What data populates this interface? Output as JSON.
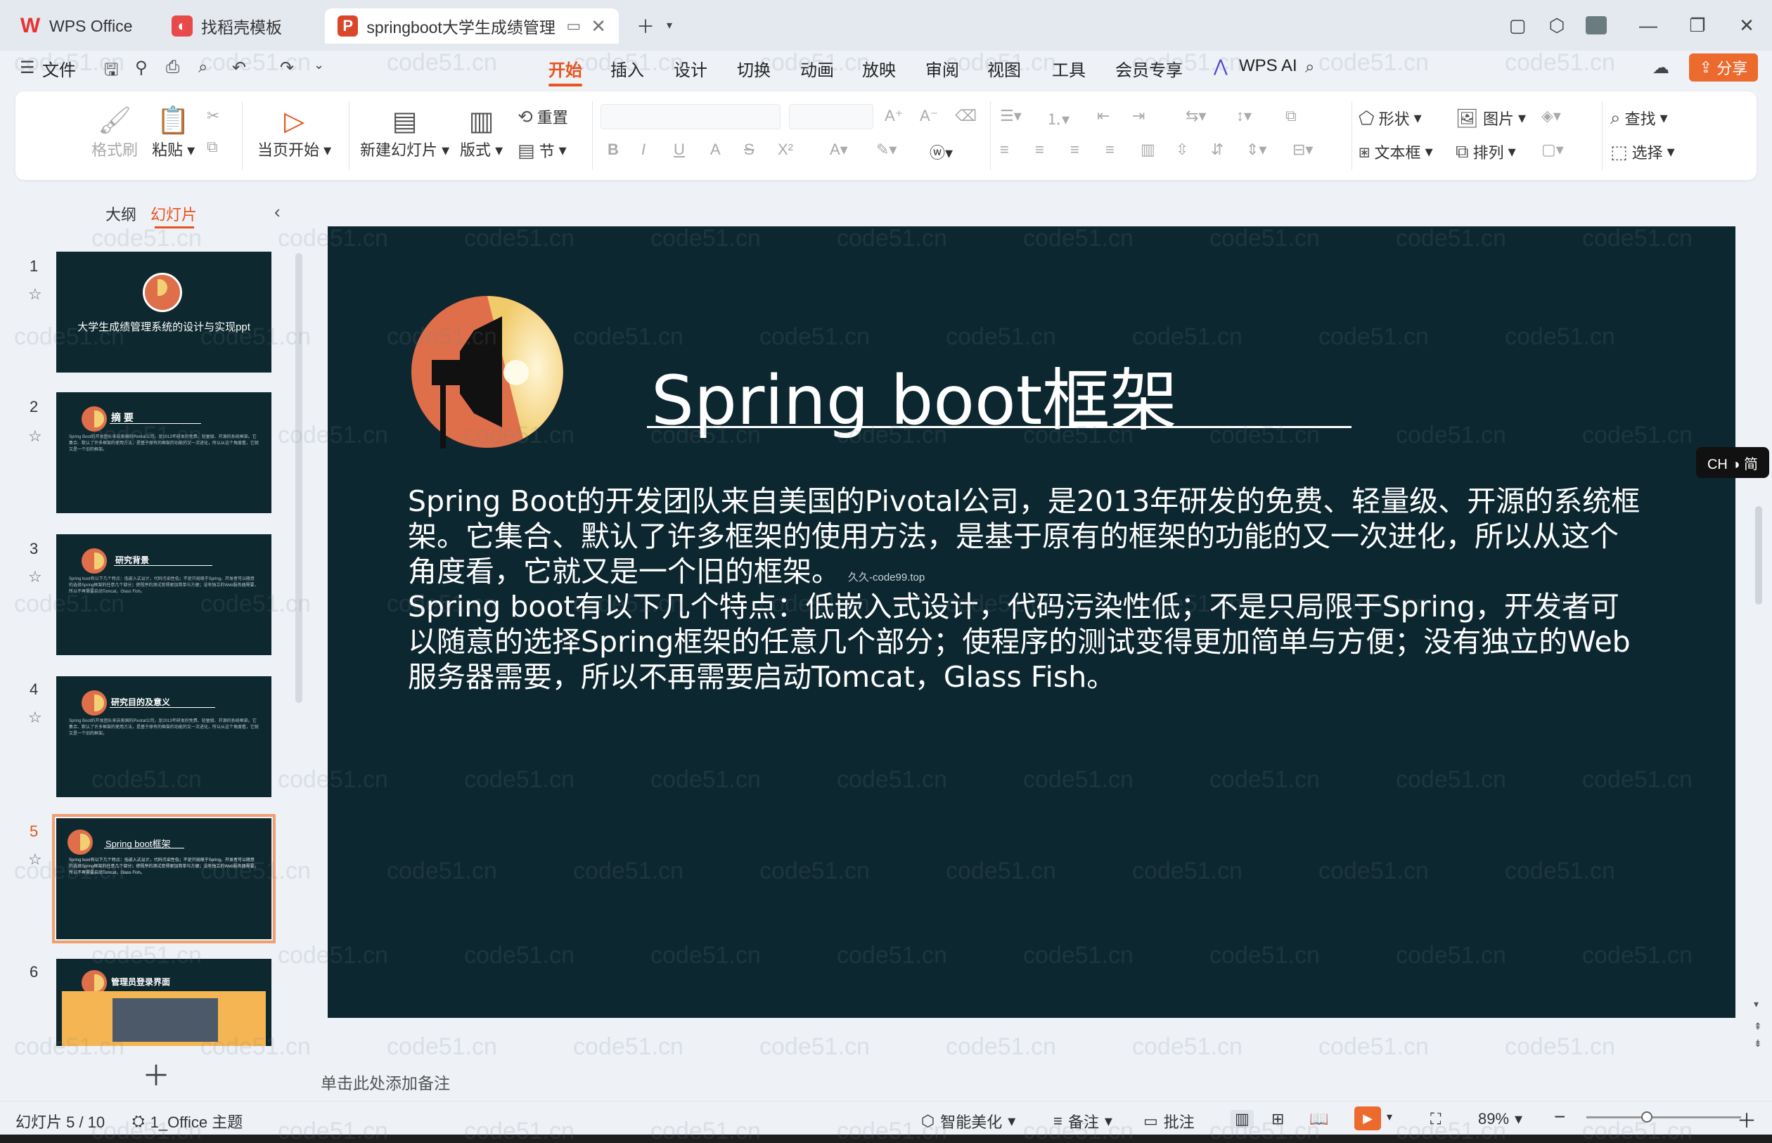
{
  "tabs": [
    {
      "label": "WPS Office",
      "logo": "W",
      "color": "#e8322f"
    },
    {
      "label": "找稻壳模板",
      "logo": "◐",
      "color": "#e84a4a"
    },
    {
      "label": "springboot大学生成绩管理系",
      "logo": "P",
      "color": "#d9462a"
    }
  ],
  "menu": {
    "file": "文件",
    "items": [
      "开始",
      "插入",
      "设计",
      "切换",
      "动画",
      "放映",
      "审阅",
      "视图",
      "工具",
      "会员专享",
      "WPS AI"
    ],
    "share": "分享"
  },
  "ribbon": {
    "format_painter": "格式刷",
    "paste": "粘贴",
    "play_from_current": "当页开始",
    "new_slide": "新建幻灯片",
    "layout": "版式",
    "reset": "重置",
    "section": "节",
    "shape": "形状",
    "picture": "图片",
    "find": "查找",
    "textbox": "文本框",
    "arrange": "排列",
    "select": "选择"
  },
  "left_pane": {
    "tab_outline": "大纲",
    "tab_slides": "幻灯片",
    "slides": [
      {
        "num": "1",
        "title": "大学生成绩管理系统的设计与实现ppt"
      },
      {
        "num": "2",
        "title": "摘 要"
      },
      {
        "num": "3",
        "title": "研究背景"
      },
      {
        "num": "4",
        "title": "研究目的及意义"
      },
      {
        "num": "5",
        "title": "Spring boot框架"
      },
      {
        "num": "6",
        "title": "管理员登录界面"
      }
    ]
  },
  "slide": {
    "title": "Spring boot框架",
    "paragraphs": [
      "Spring Boot的开发团队来自美国的Pivotal公司，是2013年研发的免费、轻量级、开源的系统框架。它集合、默认了许多框架的使用方法，是基于原有的框架的功能的又一次进化，所以从这个角度看，它就又是一个旧的框架。",
      "Spring boot有以下几个特点：低嵌入式设计，代码污染性低；不是只局限于Spring，开发者可以随意的选择Spring框架的任意几个部分；使程序的测试变得更加简单与方便；没有独立的Web服务器需要，所以不再需要启动Tomcat，Glass Fish。"
    ],
    "center_watermark": "久久-code99.top"
  },
  "notes_placeholder": "单击此处添加备注",
  "ime": "CH ◑ 简",
  "status": {
    "slide_counter": "幻灯片 5 / 10",
    "theme": "1_Office 主题",
    "beautify": "智能美化",
    "notes": "备注",
    "comments": "批注",
    "zoom": "89%"
  },
  "watermark_text": "code51.cn",
  "colors": {
    "accent": "#e8531f",
    "slide_bg": "#0d2730",
    "logo_orange": "#de6f4a",
    "logo_yellow": "#f3cf73"
  }
}
